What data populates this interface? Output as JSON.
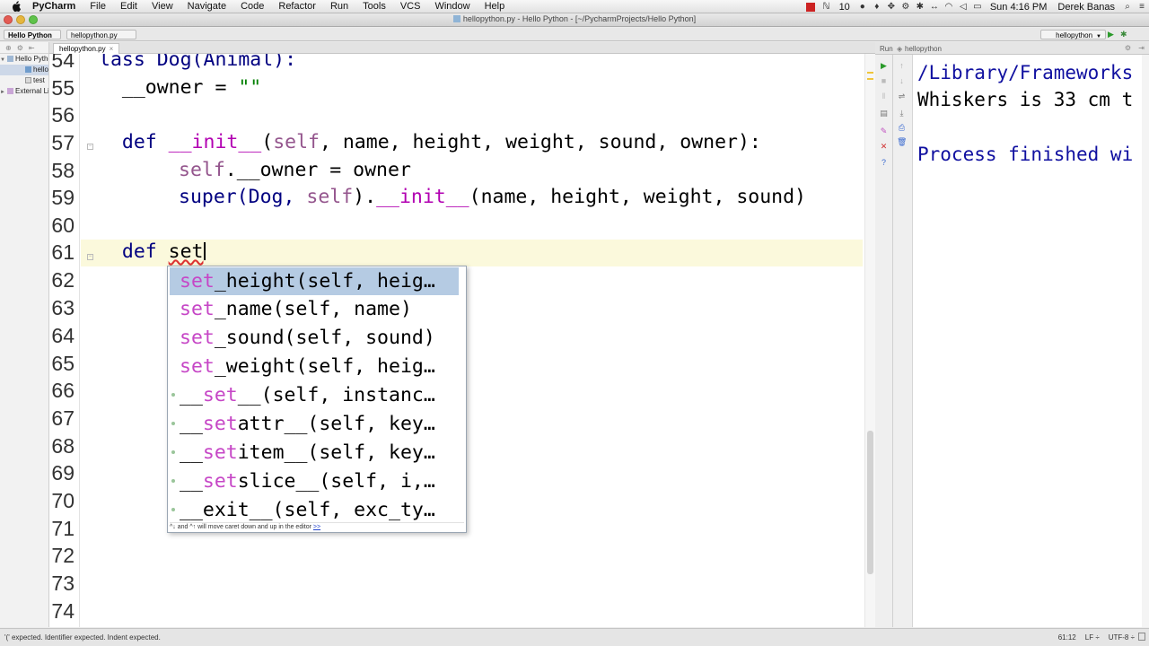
{
  "menubar": {
    "app_name": "PyCharm",
    "items": [
      "File",
      "Edit",
      "View",
      "Navigate",
      "Code",
      "Refactor",
      "Run",
      "Tools",
      "VCS",
      "Window",
      "Help"
    ],
    "battery_text": "10",
    "clock": "Sun 4:16 PM",
    "user": "Derek Banas"
  },
  "window": {
    "title": "hellopython.py - Hello Python - [~/PycharmProjects/Hello Python]"
  },
  "navbar": {
    "breadcrumb_project": "Hello Python",
    "breadcrumb_file": "hellopython.py",
    "run_config": "hellopython"
  },
  "project": {
    "items": [
      {
        "label": "Hello Python",
        "toggle": "▼"
      },
      {
        "label": "hellopython.py",
        "toggle": ""
      },
      {
        "label": "test",
        "toggle": ""
      },
      {
        "label": "External Libraries",
        "toggle": "►"
      }
    ]
  },
  "editor": {
    "tab_label": "hellopython.py",
    "line_numbers": [
      "54",
      "55",
      "56",
      "57",
      "58",
      "59",
      "60",
      "61",
      "62",
      "63",
      "64",
      "65",
      "66",
      "67",
      "68",
      "69",
      "70",
      "71",
      "72",
      "73",
      "74"
    ],
    "code_line_54": "lass Dog(Animal):",
    "code_line_55_a": "  __owner = ",
    "code_line_55_b": "\"\"",
    "code_line_57_def": "  def ",
    "code_line_57_init": "__init__",
    "code_line_57_open": "(",
    "code_line_57_self": "self",
    "code_line_57_rest": ", name, height, weight, sound, owner):",
    "code_line_58_self": "self",
    "code_line_58_rest": ".__owner = owner",
    "code_line_59_super": "super(Dog, ",
    "code_line_59_self": "self",
    "code_line_59_dot": ").",
    "code_line_59_init": "__init__",
    "code_line_59_rest": "(name, height, weight, sound)",
    "code_line_61_def": "  def ",
    "code_line_61_typed": "set"
  },
  "completion": {
    "items": [
      {
        "match": "set",
        "rest": "_height(self, heig…",
        "selected": true
      },
      {
        "match": "set",
        "rest": "_name(self, name)",
        "selected": false
      },
      {
        "match": "set",
        "rest": "_sound(self, sound)",
        "selected": false
      },
      {
        "match": "set",
        "rest": "_weight(self, heig…",
        "selected": false
      },
      {
        "prefix": "__",
        "match": "set",
        "rest": "__(self, instanc…",
        "selected": false
      },
      {
        "prefix": "__",
        "match": "set",
        "rest": "attr__(self, key…",
        "selected": false
      },
      {
        "prefix": "__",
        "match": "set",
        "rest": "item__(self, key…",
        "selected": false
      },
      {
        "prefix": "__",
        "match": "set",
        "rest": "slice__(self, i,…",
        "selected": false
      },
      {
        "prefix": "",
        "match": "",
        "rest": "__exit__(self, exc_ty…",
        "selected": false
      }
    ],
    "footer_text": "^↓ and ^↑ will move caret down and up in the editor",
    "footer_link": ">>"
  },
  "run_panel": {
    "label": "Run",
    "config": "hellopython",
    "console_lines": [
      {
        "text": "/Library/Frameworks",
        "style": "blue"
      },
      {
        "text": "Whiskers is 33 cm t",
        "style": "black"
      },
      {
        "text": "",
        "style": "black"
      },
      {
        "text": "Process finished wi",
        "style": "blue"
      }
    ]
  },
  "statusbar": {
    "message": "'(' expected. Identifier expected. Indent expected.",
    "caret_pos": "61:12",
    "line_sep": "LF ÷",
    "encoding": "UTF-8 ÷"
  },
  "colors": {
    "keyword": "#000080",
    "self": "#94558d",
    "magic": "#b200b2",
    "string": "#008000",
    "completion_selected": "#b5cbe3",
    "completion_match": "#c646c6",
    "current_line": "#fbf9dc"
  }
}
